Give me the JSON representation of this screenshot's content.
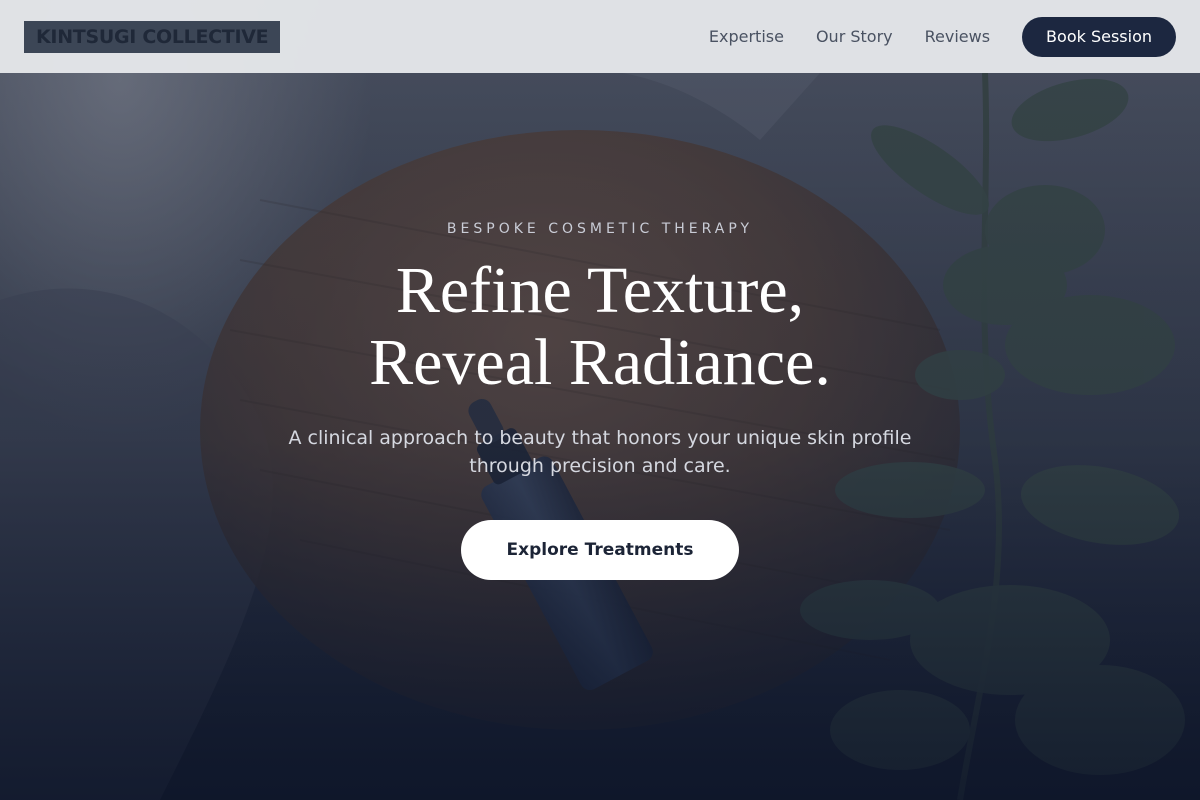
{
  "header": {
    "logo_text": "KINTSUGI COLLECTIVE",
    "nav": [
      {
        "label": "Expertise"
      },
      {
        "label": "Our Story"
      },
      {
        "label": "Reviews"
      }
    ],
    "cta_label": "Book Session"
  },
  "hero": {
    "eyebrow": "BESPOKE COSMETIC THERAPY",
    "headline_line1": "Refine Texture,",
    "headline_line2": "Reveal Radiance.",
    "subtitle": "A clinical approach to beauty that honors your unique skin profile through precision and care.",
    "cta_label": "Explore Treatments"
  },
  "colors": {
    "header_bg": "#e4e6e9",
    "logo_bg": "#3c4656",
    "primary_button": "#1c2740",
    "hero_dark": "#141b2d",
    "cta_bg": "#ffffff"
  }
}
